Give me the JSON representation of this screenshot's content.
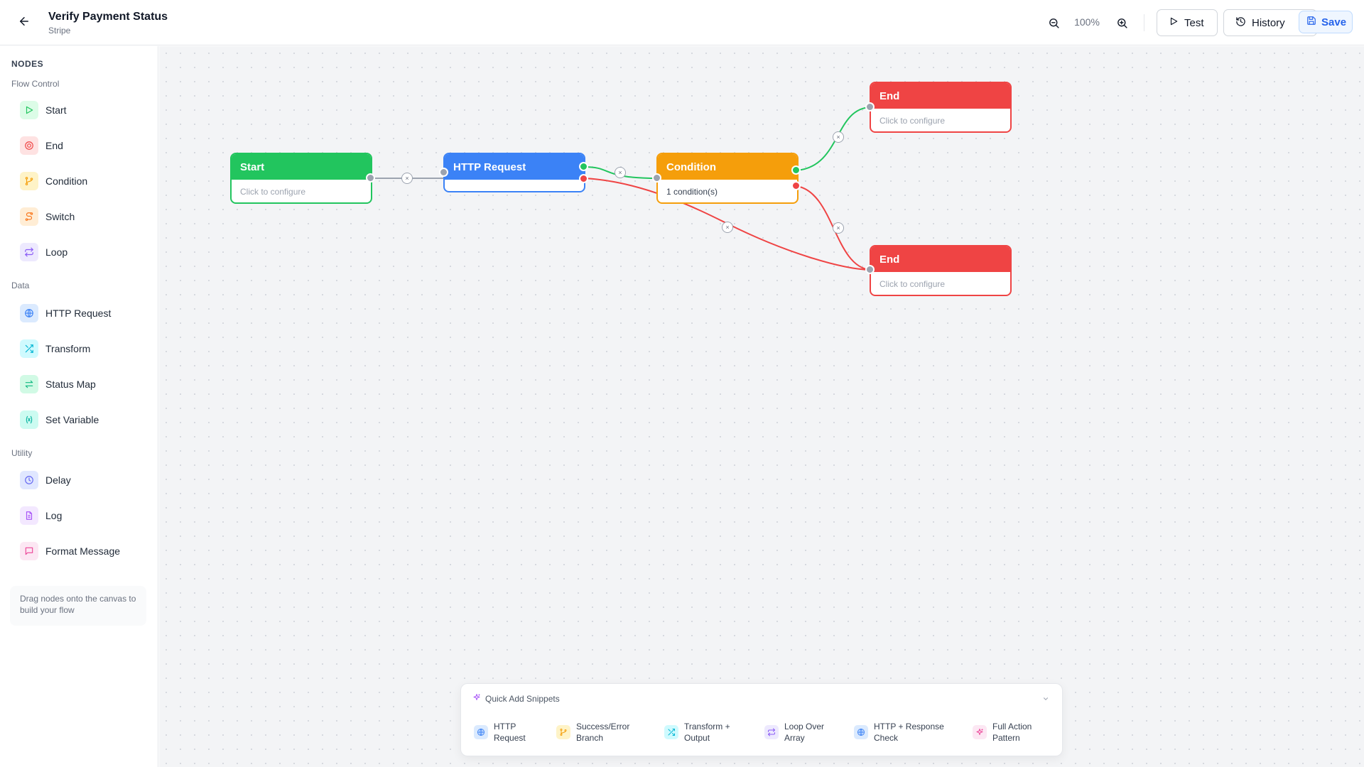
{
  "header": {
    "title": "Verify Payment Status",
    "subtitle": "Stripe",
    "zoom": "100%",
    "test_label": "Test",
    "history_label": "History",
    "save_label": "Save"
  },
  "sidebar": {
    "heading": "NODES",
    "groups": [
      {
        "label": "Flow Control",
        "items": [
          {
            "label": "Start",
            "icon": "play-icon",
            "color": "#22c55e"
          },
          {
            "label": "End",
            "icon": "target-icon",
            "color": "#ef4444"
          },
          {
            "label": "Condition",
            "icon": "branch-icon",
            "color": "#f59e0b"
          },
          {
            "label": "Switch",
            "icon": "route-icon",
            "color": "#f97316"
          },
          {
            "label": "Loop",
            "icon": "repeat-icon",
            "color": "#8b5cf6"
          }
        ]
      },
      {
        "label": "Data",
        "items": [
          {
            "label": "HTTP Request",
            "icon": "globe-icon",
            "color": "#3b82f6"
          },
          {
            "label": "Transform",
            "icon": "shuffle-icon",
            "color": "#06b6d4"
          },
          {
            "label": "Status Map",
            "icon": "arrows-left-right-icon",
            "color": "#10b981"
          },
          {
            "label": "Set Variable",
            "icon": "variable-icon",
            "color": "#14b8a6"
          }
        ]
      },
      {
        "label": "Utility",
        "items": [
          {
            "label": "Delay",
            "icon": "clock-icon",
            "color": "#6366f1"
          },
          {
            "label": "Log",
            "icon": "file-text-icon",
            "color": "#a855f7"
          },
          {
            "label": "Format Message",
            "icon": "message-square-icon",
            "color": "#ec4899"
          }
        ]
      }
    ],
    "hint": "Drag nodes onto the canvas to build your flow"
  },
  "canvas": {
    "nodes": [
      {
        "id": "start",
        "title": "Start",
        "body": "Click to configure"
      },
      {
        "id": "http",
        "title": "HTTP Request",
        "body": ""
      },
      {
        "id": "condition",
        "title": "Condition",
        "body": "1 condition(s)"
      },
      {
        "id": "end1",
        "title": "End",
        "body": "Click to configure"
      },
      {
        "id": "end2",
        "title": "End",
        "body": "Click to configure"
      }
    ],
    "edge_colors": {
      "default": "#9ca3af",
      "success": "#22c55e",
      "error": "#ef4444"
    }
  },
  "snippets": {
    "title": "Quick Add Snippets",
    "items": [
      {
        "label": "HTTP Request",
        "icon": "globe-icon",
        "color": "#3b82f6"
      },
      {
        "label": "Success/Error Branch",
        "icon": "branch-icon",
        "color": "#f59e0b"
      },
      {
        "label": "Transform + Output",
        "icon": "shuffle-icon",
        "color": "#06b6d4"
      },
      {
        "label": "Loop Over Array",
        "icon": "repeat-icon",
        "color": "#8b5cf6"
      },
      {
        "label": "HTTP + Response Check",
        "icon": "globe-icon",
        "color": "#3b82f6"
      },
      {
        "label": "Full Action Pattern",
        "icon": "sparkles-icon",
        "color": "#ec4899"
      }
    ]
  }
}
